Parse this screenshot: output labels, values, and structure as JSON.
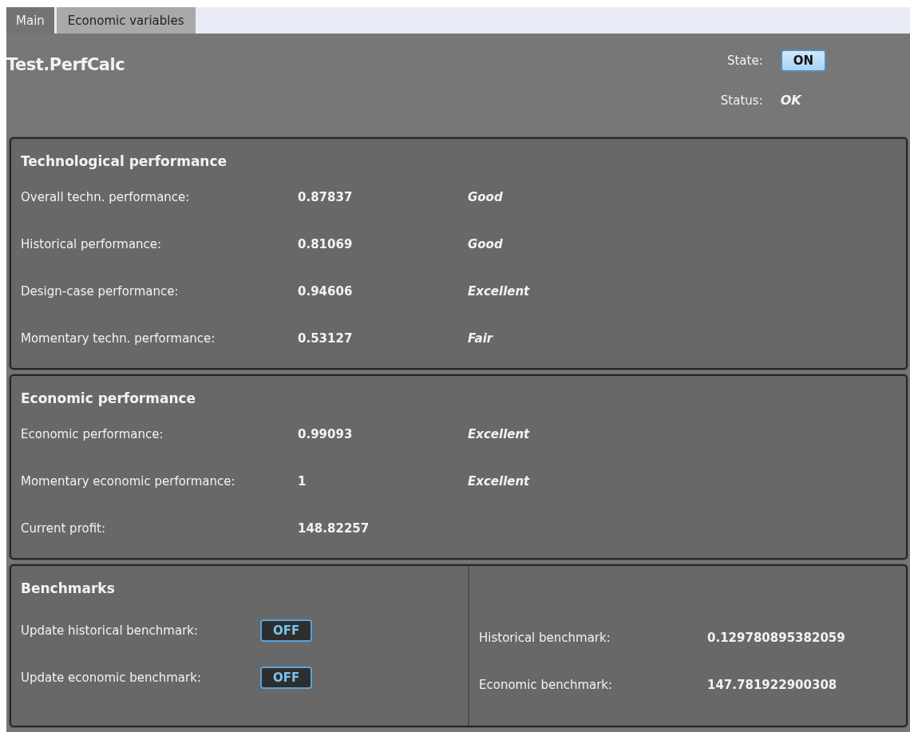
{
  "tabs": [
    {
      "label": "Main",
      "selected": true
    },
    {
      "label": "Economic variables",
      "selected": false
    }
  ],
  "header": {
    "title": "Test.PerfCalc",
    "state_label": "State:",
    "state_toggle": {
      "text": "ON",
      "on": true
    },
    "status_label": "Status:",
    "status_value": "OK"
  },
  "technological": {
    "heading": "Technological performance",
    "rows": [
      {
        "label": "Overall techn. performance:",
        "value": "0.87837",
        "rating": "Good"
      },
      {
        "label": "Historical performance:",
        "value": "0.81069",
        "rating": "Good"
      },
      {
        "label": "Design-case performance:",
        "value": "0.94606",
        "rating": "Excellent"
      },
      {
        "label": "Momentary techn. performance:",
        "value": "0.53127",
        "rating": "Fair"
      }
    ]
  },
  "economic": {
    "heading": "Economic performance",
    "rows": [
      {
        "label": "Economic performance:",
        "value": "0.99093",
        "rating": "Excellent"
      },
      {
        "label": "Momentary economic performance:",
        "value": "1",
        "rating": "Excellent"
      },
      {
        "label": "Current profit:",
        "value": "148.82257"
      }
    ]
  },
  "benchmarks": {
    "heading": "Benchmarks",
    "toggles": [
      {
        "label": "Update historical benchmark:",
        "text": "OFF",
        "on": false
      },
      {
        "label": "Update economic benchmark:",
        "text": "OFF",
        "on": false
      }
    ],
    "values": [
      {
        "label": "Historical benchmark:",
        "value": "0.129780895382059"
      },
      {
        "label": "Economic benchmark:",
        "value": "147.781922900308"
      }
    ]
  }
}
